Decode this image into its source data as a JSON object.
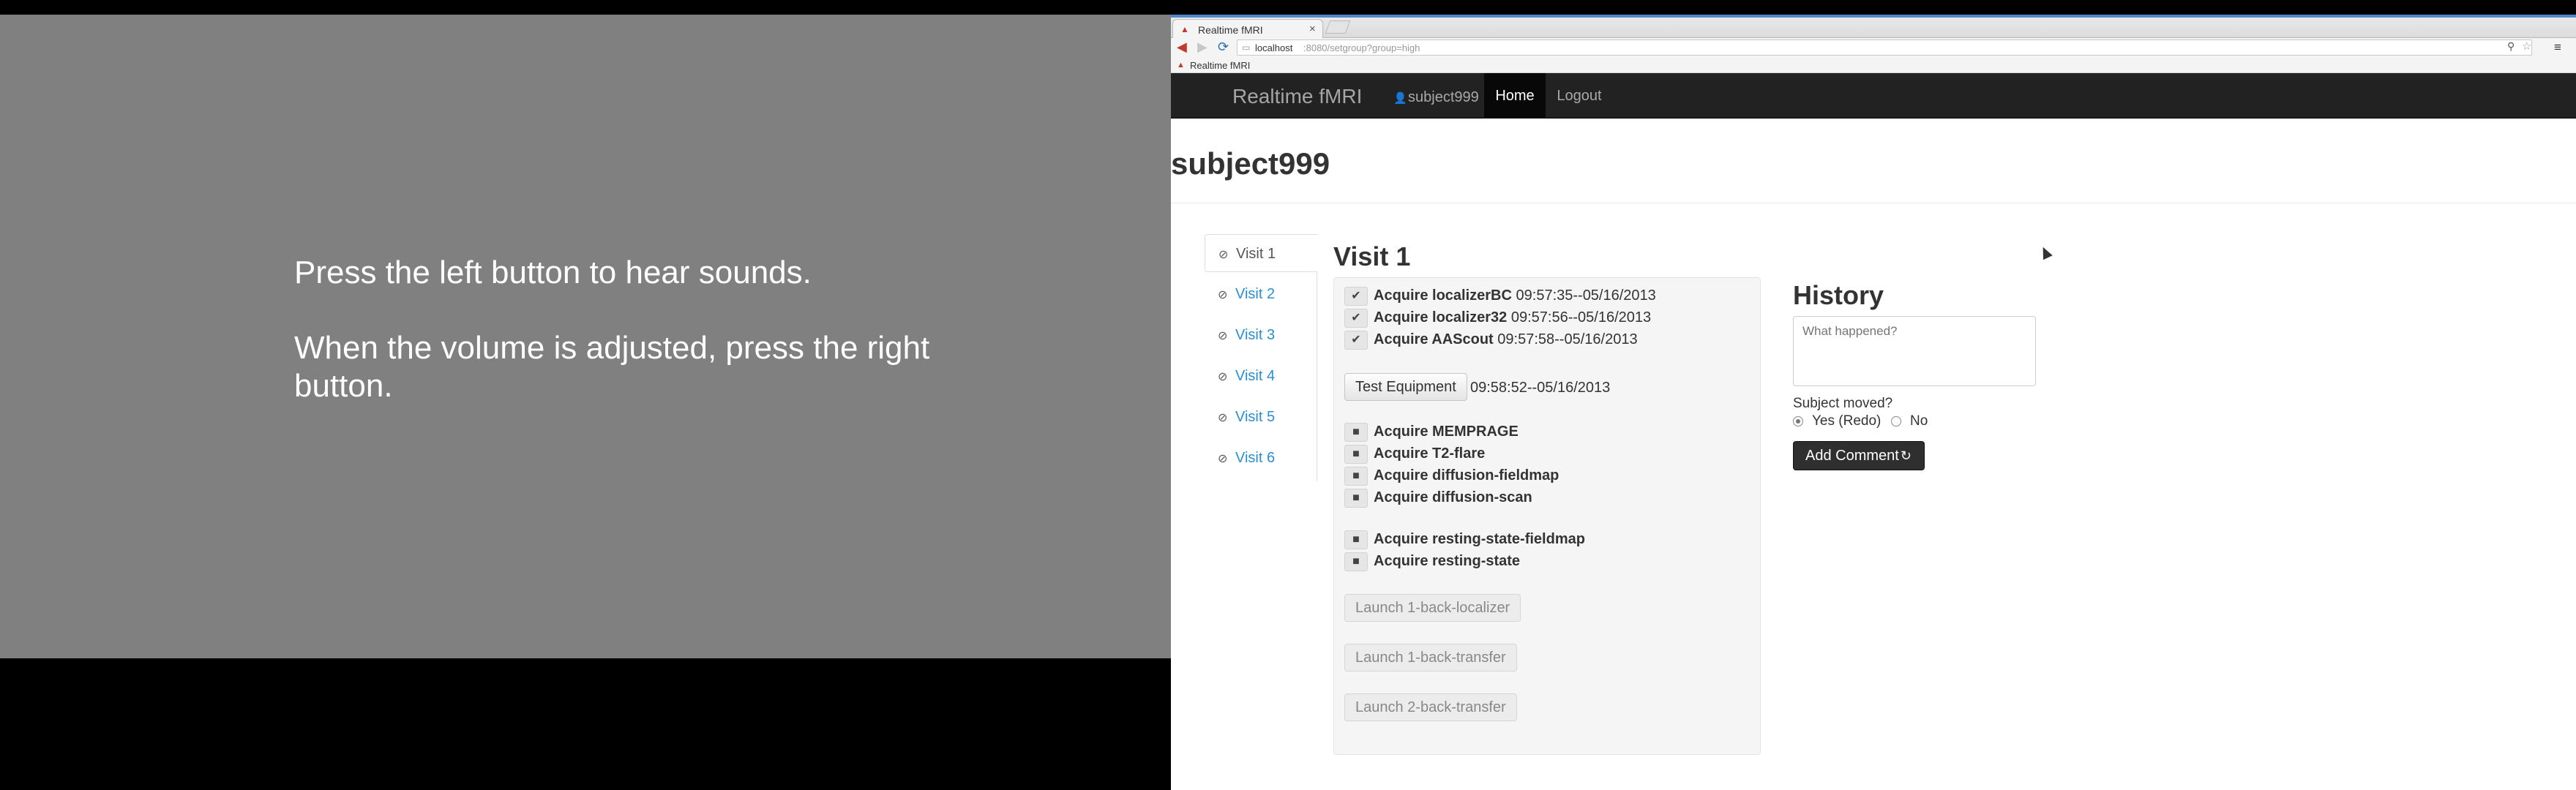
{
  "stimulus": {
    "line1": "Press the left button to hear sounds.",
    "line2": "When the volume is adjusted, press the right  button."
  },
  "browser": {
    "tab_title": "Realtime fMRI",
    "url_host": "localhost",
    "url_rest": ":8080/setgroup?group=high",
    "bookmark": "Realtime fMRI"
  },
  "navbar": {
    "brand": "Realtime fMRI",
    "user": "subject999",
    "home": "Home",
    "logout": "Logout"
  },
  "page": {
    "title": "subject999"
  },
  "visits": [
    {
      "label": "Visit 1"
    },
    {
      "label": "Visit 2"
    },
    {
      "label": "Visit 3"
    },
    {
      "label": "Visit 4"
    },
    {
      "label": "Visit 5"
    },
    {
      "label": "Visit 6"
    }
  ],
  "visit": {
    "title": "Visit 1",
    "done_steps": [
      {
        "name": "Acquire localizerBC",
        "time": "09:57:35--05/16/2013"
      },
      {
        "name": "Acquire localizer32",
        "time": "09:57:56--05/16/2013"
      },
      {
        "name": "Acquire AAScout",
        "time": "09:57:58--05/16/2013"
      }
    ],
    "test_button": "Test Equipment",
    "test_time": "09:58:52--05/16/2013",
    "pending_steps_a": [
      {
        "name": "Acquire MEMPRAGE"
      },
      {
        "name": "Acquire T2-flare"
      },
      {
        "name": "Acquire diffusion-fieldmap"
      },
      {
        "name": "Acquire diffusion-scan"
      }
    ],
    "pending_steps_b": [
      {
        "name": "Acquire resting-state-fieldmap"
      },
      {
        "name": "Acquire resting-state"
      }
    ],
    "launch_buttons": [
      {
        "label": "Launch 1-back-localizer"
      },
      {
        "label": "Launch 1-back-transfer"
      },
      {
        "label": "Launch 2-back-transfer"
      }
    ]
  },
  "history": {
    "title": "History",
    "placeholder": "What happened?",
    "moved_label": "Subject moved?",
    "yes_label": "Yes (Redo)",
    "no_label": "No",
    "yes_selected": true,
    "add_comment": "Add Comment"
  },
  "icons": {
    "check": "check-icon",
    "stop": "stop-square-icon",
    "user": "user-icon",
    "refresh": "refresh-icon"
  }
}
